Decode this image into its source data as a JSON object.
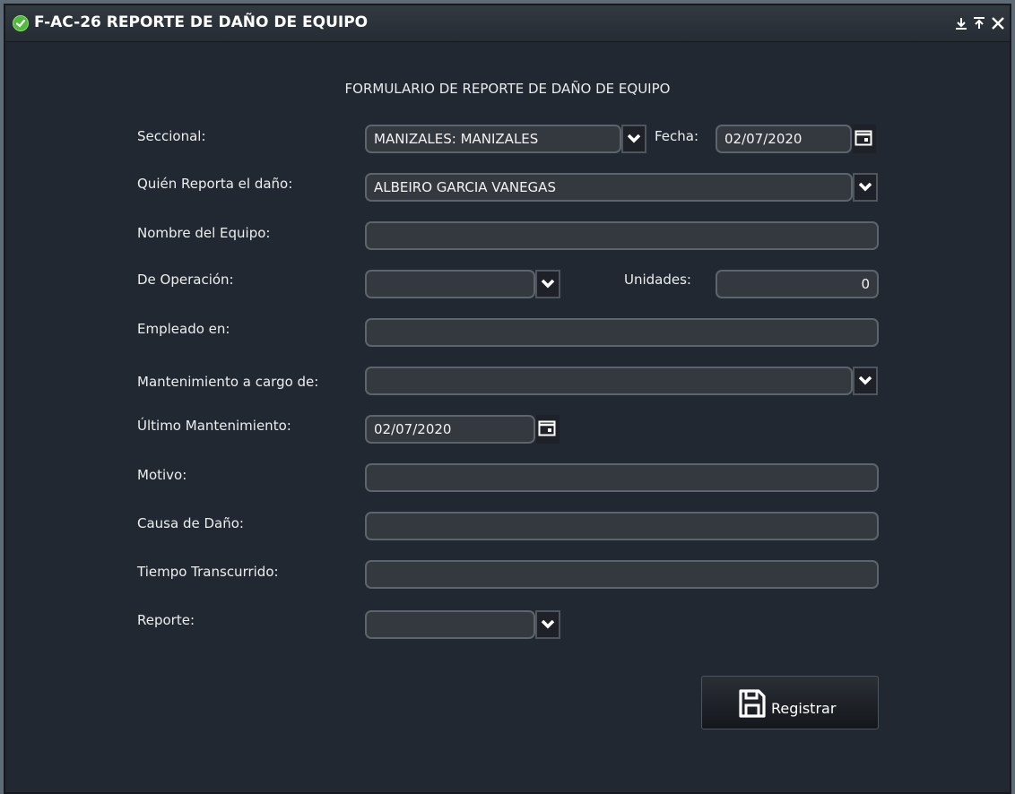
{
  "window": {
    "title": "F-AC-26 REPORTE DE DAÑO DE EQUIPO",
    "status_icon": "check-circle-icon",
    "controls": [
      "download-icon",
      "pin-top-icon",
      "close-icon"
    ]
  },
  "form": {
    "heading": "FORMULARIO DE REPORTE DE DAÑO DE EQUIPO",
    "seccional": {
      "label": "Seccional:",
      "value": "MANIZALES: MANIZALES"
    },
    "fecha": {
      "label": "Fecha:",
      "value": "02/07/2020"
    },
    "quien_reporta": {
      "label": "Quién Reporta el daño:",
      "value": "ALBEIRO GARCIA VANEGAS"
    },
    "nombre_equipo": {
      "label": "Nombre del Equipo:",
      "value": ""
    },
    "de_operacion": {
      "label": "De Operación:",
      "value": ""
    },
    "unidades": {
      "label": "Unidades:",
      "value": "0"
    },
    "empleado_en": {
      "label": "Empleado en:",
      "value": ""
    },
    "mantenimiento_cargo": {
      "label": "Mantenimiento a cargo de:",
      "value": ""
    },
    "ultimo_mantenimiento": {
      "label": "Último Mantenimiento:",
      "value": "02/07/2020"
    },
    "motivo": {
      "label": "Motivo:",
      "value": ""
    },
    "causa_dano": {
      "label": "Causa de Daño:",
      "value": ""
    },
    "tiempo_transcurrido": {
      "label": "Tiempo Transcurrido:",
      "value": ""
    },
    "reporte": {
      "label": "Reporte:",
      "value": ""
    },
    "register_button": {
      "label": "Registrar",
      "icon": "save-icon"
    }
  },
  "colors": {
    "window_bg": "#222831",
    "field_bg": "#343940",
    "field_border": "#5d646b",
    "status_green": "#4fbd3a"
  }
}
